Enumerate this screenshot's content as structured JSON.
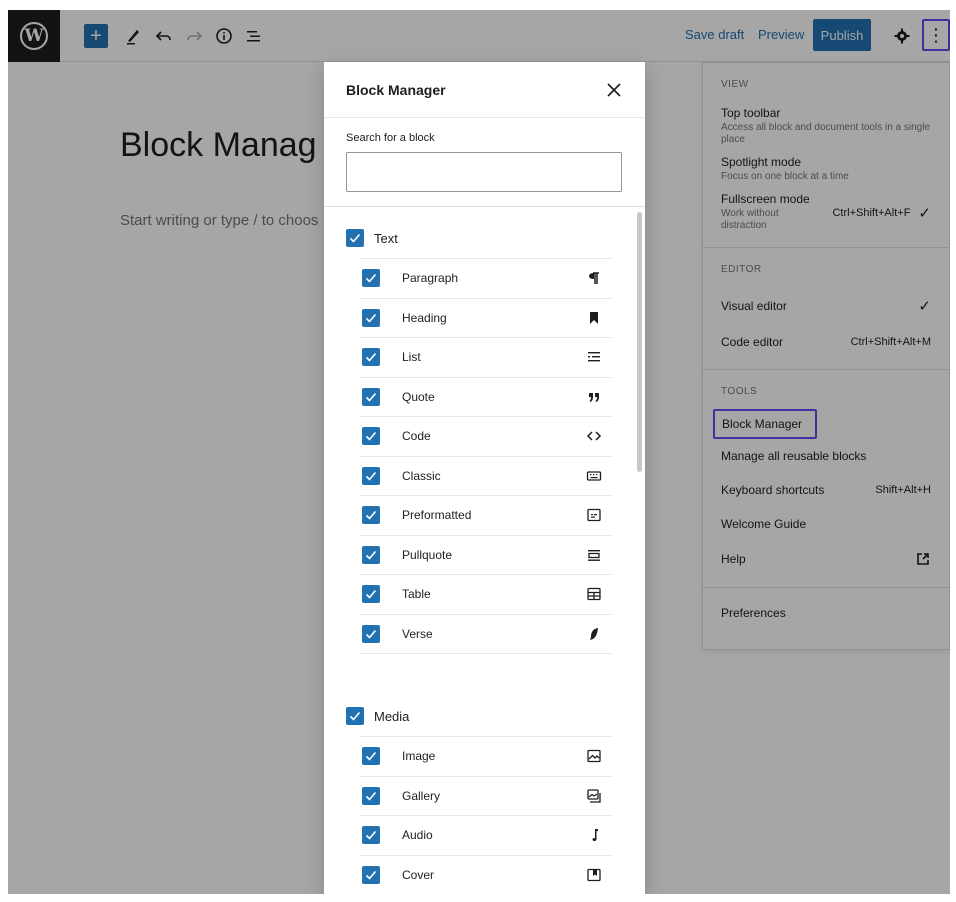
{
  "topbar": {
    "logo_glyph": "W",
    "add_glyph": "+",
    "save_draft": "Save draft",
    "preview": "Preview",
    "publish": "Publish",
    "kebab_glyph": "⋮"
  },
  "editor": {
    "title": "Block Manag",
    "placeholder": "Start writing or type / to choos"
  },
  "menu": {
    "view_title": "VIEW",
    "top_toolbar": "Top toolbar",
    "top_toolbar_desc": "Access all block and document tools in a single place",
    "spotlight": "Spotlight mode",
    "spotlight_desc": "Focus on one block at a time",
    "fullscreen": "Fullscreen mode",
    "fullscreen_desc": "Work without distraction",
    "fullscreen_shortcut": "Ctrl+Shift+Alt+F",
    "editor_title": "EDITOR",
    "visual_editor": "Visual editor",
    "code_editor": "Code editor",
    "code_editor_shortcut": "Ctrl+Shift+Alt+M",
    "tools_title": "TOOLS",
    "block_manager": "Block Manager",
    "manage_reusable": "Manage all reusable blocks",
    "keyboard_shortcuts": "Keyboard shortcuts",
    "keyboard_shortcuts_shortcut": "Shift+Alt+H",
    "welcome_guide": "Welcome Guide",
    "help": "Help",
    "preferences": "Preferences",
    "check_glyph": "✓"
  },
  "modal": {
    "title": "Block Manager",
    "search_label": "Search for a block",
    "search_value": "",
    "categories": [
      {
        "label": "Text",
        "blocks": [
          "Paragraph",
          "Heading",
          "List",
          "Quote",
          "Code",
          "Classic",
          "Preformatted",
          "Pullquote",
          "Table",
          "Verse"
        ]
      },
      {
        "label": "Media",
        "blocks": [
          "Image",
          "Gallery",
          "Audio",
          "Cover"
        ]
      }
    ]
  },
  "colors": {
    "accent": "#2271b1",
    "highlight": "#5b4df5",
    "overlay": "rgba(0,0,0,0.35)"
  }
}
